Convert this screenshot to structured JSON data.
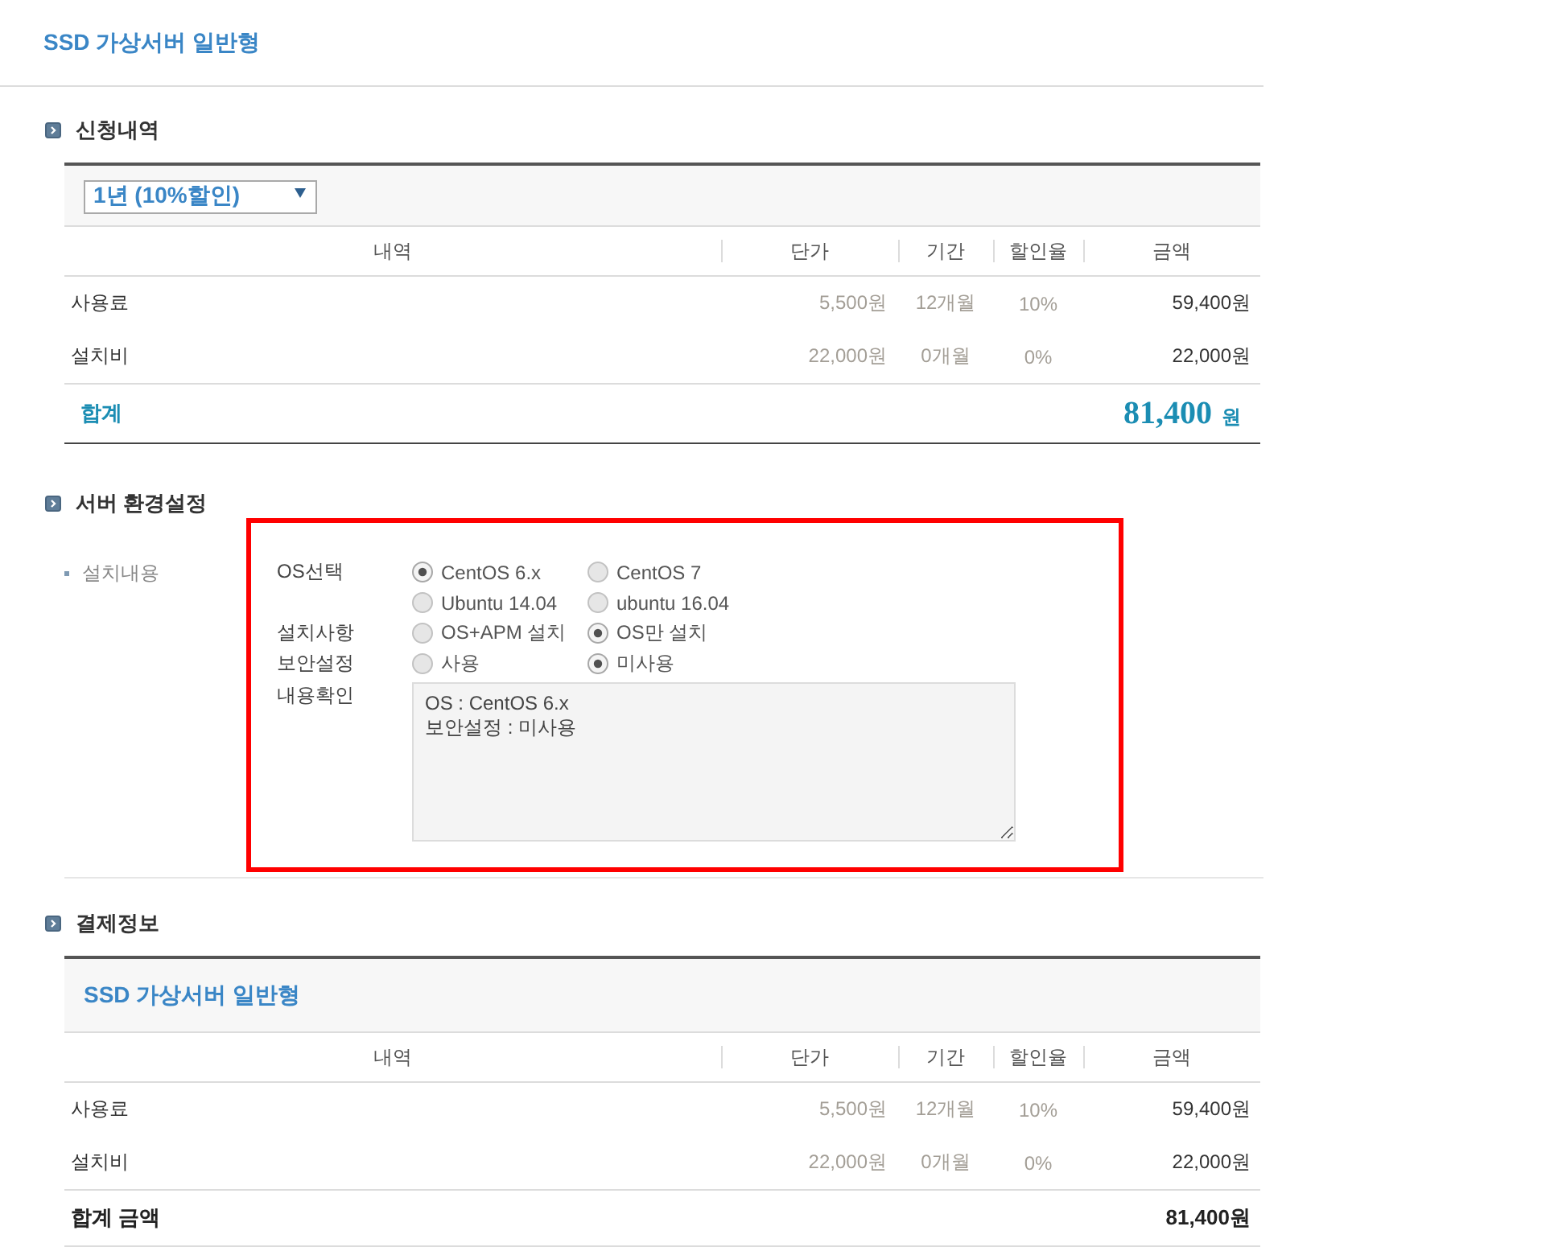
{
  "page_title": "SSD 가상서버 일반형",
  "application": {
    "heading": "신청내역",
    "term_select": {
      "value": "1년 (10%할인)"
    },
    "table": {
      "columns": [
        "내역",
        "단가",
        "기간",
        "할인율",
        "금액"
      ],
      "rows": [
        {
          "item": "사용료",
          "unit_price": "5,500원",
          "period": "12개월",
          "discount": "10%",
          "amount": "59,400원"
        },
        {
          "item": "설치비",
          "unit_price": "22,000원",
          "period": "0개월",
          "discount": "0%",
          "amount": "22,000원"
        }
      ],
      "total": {
        "label": "합계",
        "amount": "81,400",
        "unit": "원"
      }
    }
  },
  "server_settings": {
    "heading": "서버 환경설정",
    "field_label": "설치내용",
    "highlighted": true,
    "groups": [
      {
        "label": "OS선택",
        "options": [
          {
            "label": "CentOS 6.x",
            "selected": true
          },
          {
            "label": "CentOS 7",
            "selected": false
          },
          {
            "label": "Ubuntu 14.04",
            "selected": false
          },
          {
            "label": "ubuntu 16.04",
            "selected": false
          }
        ]
      },
      {
        "label": "설치사항",
        "options": [
          {
            "label": "OS+APM 설치",
            "selected": false
          },
          {
            "label": "OS만 설치",
            "selected": true
          }
        ]
      },
      {
        "label": "보안설정",
        "options": [
          {
            "label": "사용",
            "selected": false
          },
          {
            "label": "미사용",
            "selected": true
          }
        ]
      }
    ],
    "summary": {
      "label": "내용확인",
      "value": "OS : CentOS 6.x\n보안설정 : 미사용"
    }
  },
  "payment": {
    "heading": "결제정보",
    "product_title": "SSD 가상서버 일반형",
    "table": {
      "columns": [
        "내역",
        "단가",
        "기간",
        "할인율",
        "금액"
      ],
      "rows": [
        {
          "item": "사용료",
          "unit_price": "5,500원",
          "period": "12개월",
          "discount": "10%",
          "amount": "59,400원"
        },
        {
          "item": "설치비",
          "unit_price": "22,000원",
          "period": "0개월",
          "discount": "0%",
          "amount": "22,000원"
        }
      ]
    },
    "total": {
      "label": "합계 금액",
      "amount": "81,400원"
    }
  }
}
